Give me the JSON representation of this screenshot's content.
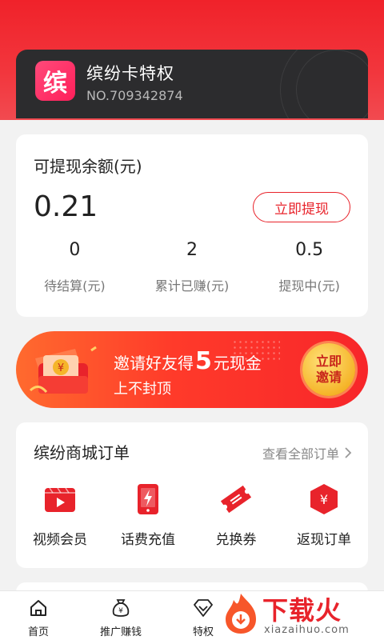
{
  "vip": {
    "logo_char": "缤",
    "title": "缤纷卡特权",
    "number": "NO.709342874"
  },
  "balance": {
    "title": "可提现余额(元)",
    "value": "0.21",
    "withdraw_label": "立即提现",
    "stats": [
      {
        "value": "0",
        "label": "待结算(元)"
      },
      {
        "value": "2",
        "label": "累计已赚(元)"
      },
      {
        "value": "0.5",
        "label": "提现中(元)"
      }
    ]
  },
  "banner": {
    "line1_pre": "邀请好友得",
    "line1_big": "5",
    "line1_post": "元现金",
    "line2": "上不封顶",
    "button_line1": "立即",
    "button_line2": "邀请"
  },
  "orders": {
    "title": "缤纷商城订单",
    "view_all": "查看全部订单",
    "items": [
      {
        "label": "视频会员",
        "icon": "video-icon"
      },
      {
        "label": "话费充值",
        "icon": "phone-recharge-icon"
      },
      {
        "label": "兑换券",
        "icon": "ticket-icon"
      },
      {
        "label": "返现订单",
        "icon": "cashback-icon"
      }
    ]
  },
  "tabbar": {
    "items": [
      {
        "label": "首页",
        "icon": "home-icon"
      },
      {
        "label": "推广赚钱",
        "icon": "money-bag-icon"
      },
      {
        "label": "特权",
        "icon": "diamond-icon"
      }
    ]
  },
  "watermark": {
    "text": "下载火",
    "sub": "xiazaihuo.com"
  },
  "colors": {
    "brand_red": "#e8232b",
    "card_dark": "#2c2c2e",
    "coin_gold": "#f5b52a"
  }
}
